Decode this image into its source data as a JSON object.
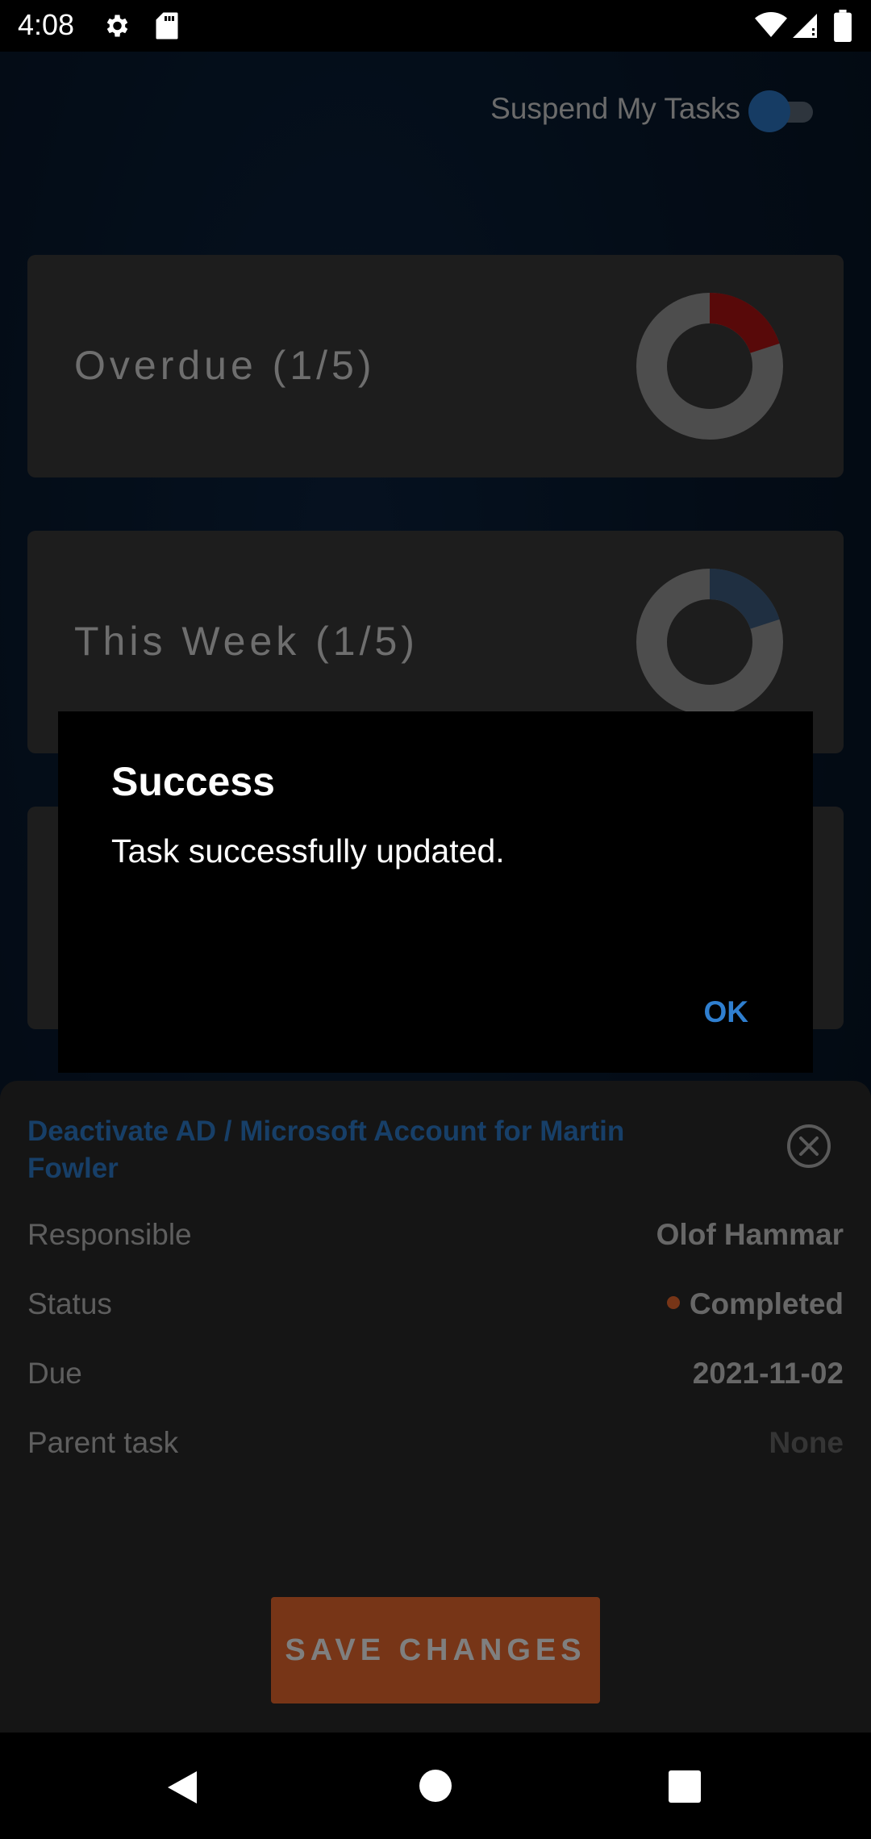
{
  "status_bar": {
    "time": "4:08",
    "icons": [
      "gear-icon",
      "sd-card-icon",
      "wifi-icon",
      "signal-icon",
      "battery-icon"
    ]
  },
  "header": {
    "suspend_label": "Suspend My Tasks",
    "suspend_toggle_on": true
  },
  "cards": [
    {
      "label": "Overdue (1/5)",
      "done": 1,
      "total": 5,
      "accent_color": "#b01313"
    },
    {
      "label": "This Week (1/5)",
      "done": 1,
      "total": 5,
      "accent_color": "#3e5f82"
    }
  ],
  "task": {
    "title": "Deactivate AD / Microsoft Account for Martin Fowler",
    "fields": [
      {
        "label": "Responsible",
        "value": "Olof Hammar"
      },
      {
        "label": "Status",
        "value": "Completed"
      },
      {
        "label": "Due",
        "value": "2021-11-02"
      },
      {
        "label": "Parent task",
        "value": "None"
      }
    ],
    "save_label": "SAVE CHANGES"
  },
  "dialog": {
    "title": "Success",
    "message": "Task successfully updated.",
    "ok_label": "OK"
  },
  "colors": {
    "accent_orange": "#ee6a2f",
    "link_blue": "#2f7fd0",
    "overdue_red": "#b01313"
  }
}
